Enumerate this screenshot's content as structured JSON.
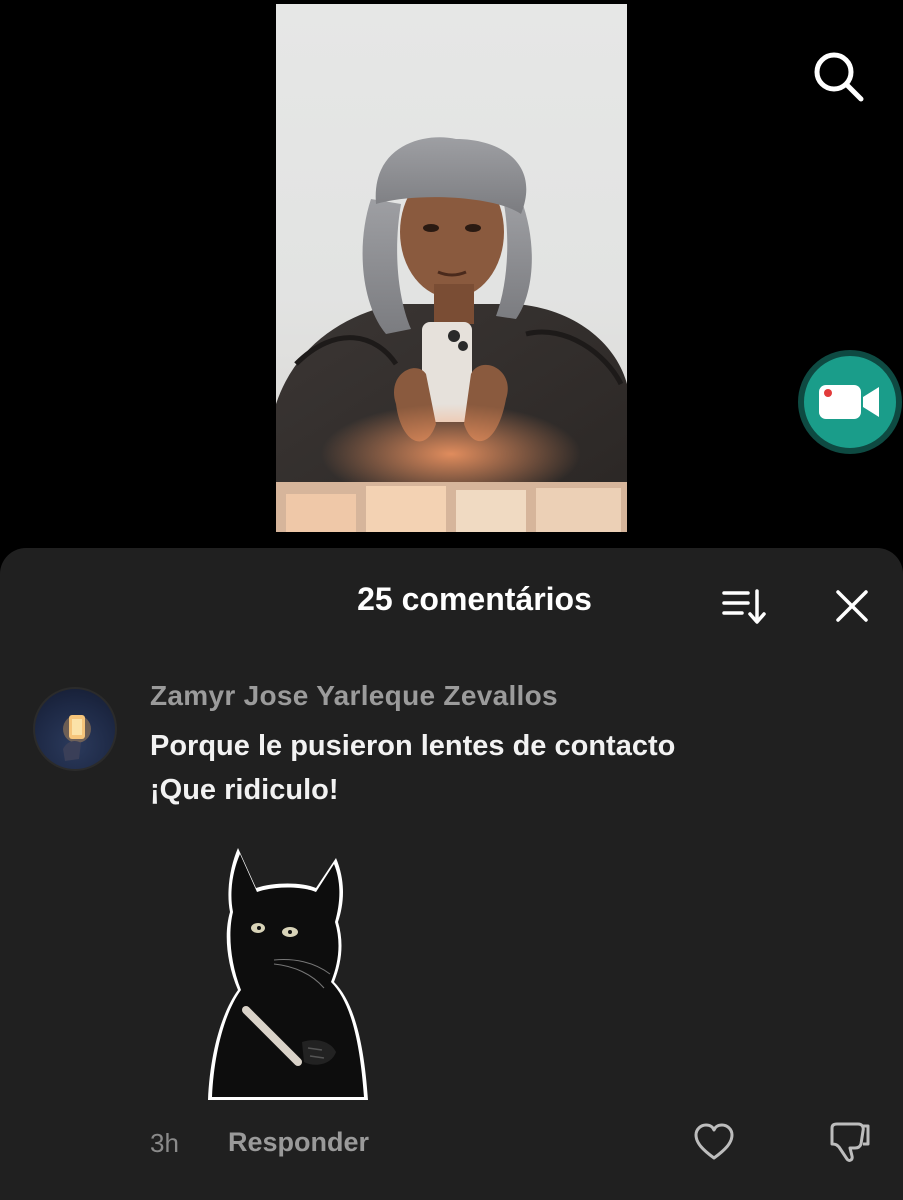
{
  "video": {
    "icons": {
      "search": "search-icon",
      "camera": "video-camera-icon"
    },
    "accent_color": "#1a9d8a"
  },
  "comments_sheet": {
    "title": "25 comentários",
    "icons": {
      "sort": "sort-icon",
      "close": "close-icon"
    },
    "background": "#202020"
  },
  "comment": {
    "username": "Zamyr Jose Yarleque Zevallos",
    "text_line1": "Porque le pusieron lentes de contacto",
    "text_line2": "¡Que ridiculo!",
    "time": "3h",
    "reply_label": "Responder",
    "icons": {
      "like": "heart-icon",
      "dislike": "thumbs-down-icon",
      "sticker": "black-cat-sticker"
    }
  }
}
